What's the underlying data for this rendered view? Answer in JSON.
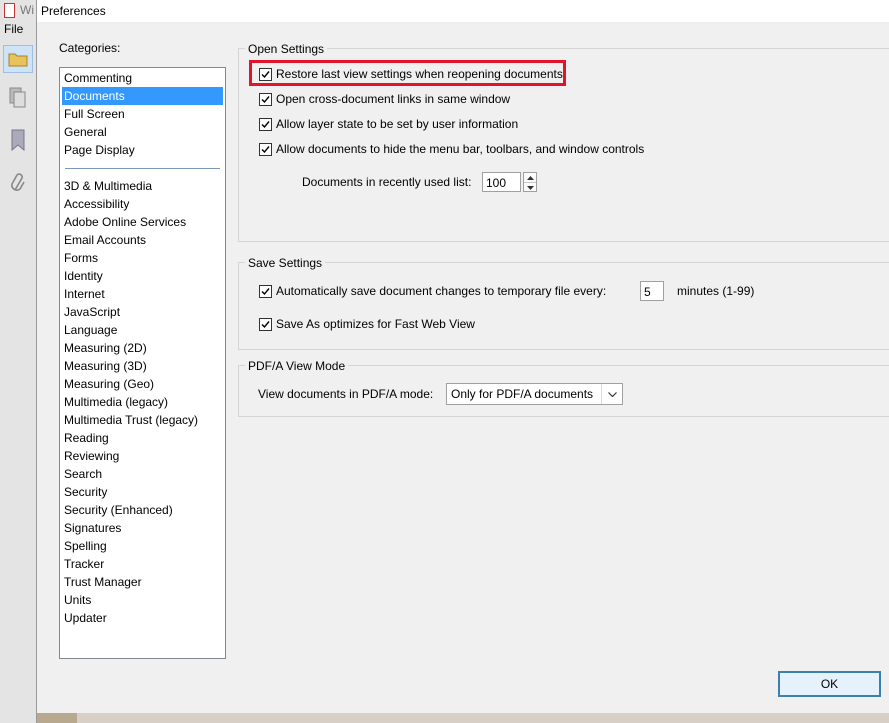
{
  "app": {
    "tab_fragment": "Wi",
    "menu_file": "File"
  },
  "dialog": {
    "title": "Preferences"
  },
  "categories": {
    "label": "Categories:",
    "top_items": [
      "Commenting",
      "Documents",
      "Full Screen",
      "General",
      "Page Display"
    ],
    "selected": "Documents",
    "bottom_items": [
      "3D & Multimedia",
      "Accessibility",
      "Adobe Online Services",
      "Email Accounts",
      "Forms",
      "Identity",
      "Internet",
      "JavaScript",
      "Language",
      "Measuring (2D)",
      "Measuring (3D)",
      "Measuring (Geo)",
      "Multimedia (legacy)",
      "Multimedia Trust (legacy)",
      "Reading",
      "Reviewing",
      "Search",
      "Security",
      "Security (Enhanced)",
      "Signatures",
      "Spelling",
      "Tracker",
      "Trust Manager",
      "Units",
      "Updater"
    ]
  },
  "open_settings": {
    "title": "Open Settings",
    "restore_view": {
      "label": "Restore last view settings when reopening documents",
      "checked": true
    },
    "cross_doc_links": {
      "label": "Open cross-document links in same window",
      "checked": true
    },
    "layer_state": {
      "label": "Allow layer state to be set by user information",
      "checked": true
    },
    "hide_menu": {
      "label": "Allow documents to hide the menu bar, toolbars, and window controls",
      "checked": true
    },
    "recent_list_label": "Documents in recently used list:",
    "recent_list_value": "100"
  },
  "save_settings": {
    "title": "Save Settings",
    "autosave": {
      "label": "Automatically save document changes to temporary file every:",
      "checked": true
    },
    "autosave_minutes": "5",
    "minutes_label": "minutes (1-99)",
    "fast_web_view": {
      "label": "Save As optimizes for Fast Web View",
      "checked": true
    }
  },
  "pdfa": {
    "title": "PDF/A View Mode",
    "mode_label": "View documents in PDF/A mode:",
    "mode_value": "Only for PDF/A documents"
  },
  "buttons": {
    "ok": "OK"
  },
  "colors": {
    "selection": "#3399ff",
    "highlight": "#e0142b",
    "ok_border": "#3c7fb1"
  }
}
